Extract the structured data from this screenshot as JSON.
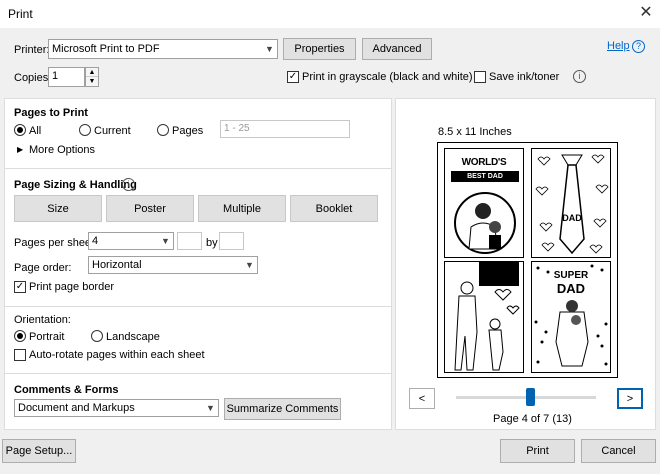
{
  "window": {
    "title": "Print",
    "close": "✕"
  },
  "printer": {
    "label": "Printer:",
    "value": "Microsoft Print to PDF",
    "properties": "Properties",
    "advanced": "Advanced",
    "help": "Help",
    "help_icon": "?",
    "copies_label": "Copies:",
    "copies_value": "1",
    "grayscale_label": "Print in grayscale (black and white)",
    "grayscale_checked": "✓",
    "save_ink_label": "Save ink/toner",
    "info_icon": "i"
  },
  "pages": {
    "title": "Pages to Print",
    "all": "All",
    "current": "Current",
    "pages": "Pages",
    "range_placeholder": "1 - 25",
    "more_options": "More Options",
    "more_arrow": "▶"
  },
  "sizing": {
    "title": "Page Sizing & Handling",
    "info_icon": "i",
    "tabs": [
      "Size",
      "Poster",
      "Multiple",
      "Booklet"
    ],
    "pps_label": "Pages per sheet:",
    "pps_value": "4",
    "by_label": "by",
    "order_label": "Page order:",
    "order_value": "Horizontal",
    "border_label": "Print page border",
    "border_checked": "✓"
  },
  "orientation": {
    "title": "Orientation:",
    "portrait": "Portrait",
    "landscape": "Landscape",
    "autorotate": "Auto-rotate pages within each sheet"
  },
  "comments": {
    "title": "Comments & Forms",
    "value": "Document and Markups",
    "summarize": "Summarize Comments"
  },
  "preview": {
    "size_label": "8.5 x 11 Inches",
    "page_label": "Page 4 of 7 (13)",
    "prev": "<",
    "next": ">",
    "slider_fraction": 0.53,
    "cells": {
      "worlds": "WORLD'S",
      "best_dad": "BEST DAD",
      "dad": "DAD",
      "super": "SUPER",
      "dad2": "DAD"
    }
  },
  "footer": {
    "page_setup": "Page Setup...",
    "print": "Print",
    "cancel": "Cancel"
  }
}
